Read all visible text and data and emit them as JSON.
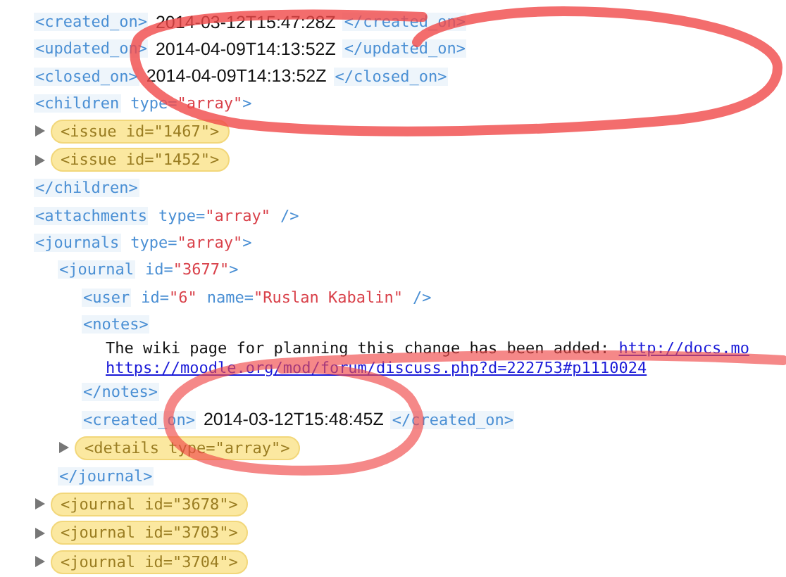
{
  "nodes": [
    {
      "kind": "leaf",
      "open": "<created_on>",
      "value": "2014-03-12T15:47:28Z",
      "close": "</created_on>"
    },
    {
      "kind": "leaf",
      "open": "<updated_on>",
      "value": "2014-04-09T14:13:52Z",
      "close": "</updated_on>"
    },
    {
      "kind": "leaf",
      "open": "<closed_on>",
      "value": "2014-04-09T14:13:52Z",
      "close": "</closed_on>"
    },
    {
      "kind": "element",
      "open": "<children",
      "attrs": [
        {
          "name": "type=",
          "value": "\"array\""
        }
      ],
      "end": ">",
      "close": "</children>",
      "children": [
        {
          "kind": "collapsed",
          "open": "<issue",
          "attrs": [
            {
              "name": "id=",
              "value": "\"1467\""
            }
          ],
          "end": ">"
        },
        {
          "kind": "collapsed",
          "open": "<issue",
          "attrs": [
            {
              "name": "id=",
              "value": "\"1452\""
            }
          ],
          "end": ">"
        }
      ]
    },
    {
      "kind": "empty",
      "open": "<attachments",
      "attrs": [
        {
          "name": "type=",
          "value": "\"array\""
        }
      ],
      "end": "/>"
    },
    {
      "kind": "element",
      "open": "<journals",
      "attrs": [
        {
          "name": "type=",
          "value": "\"array\""
        }
      ],
      "end": ">",
      "children": [
        {
          "kind": "element",
          "open": "<journal",
          "attrs": [
            {
              "name": "id=",
              "value": "\"3677\""
            }
          ],
          "end": ">",
          "close": "</journal>",
          "children": [
            {
              "kind": "empty",
              "open": "<user",
              "attrs": [
                {
                  "name": "id=",
                  "value": "\"6\""
                },
                {
                  "name": "name=",
                  "value": "\"Ruslan Kabalin\""
                }
              ],
              "end": "/>"
            },
            {
              "kind": "text",
              "open": "<notes>",
              "text": "The wiki page for planning this change has been added:",
              "links": [
                "http://docs.mo",
                "https://moodle.org/mod/forum/discuss.php?d=222753#p1110024"
              ],
              "close": "</notes>"
            },
            {
              "kind": "leaf",
              "open": "<created_on>",
              "value": "2014-03-12T15:48:45Z",
              "close": "</created_on>"
            },
            {
              "kind": "collapsed",
              "open": "<details",
              "attrs": [
                {
                  "name": "type=",
                  "value": "\"array\""
                }
              ],
              "end": ">"
            }
          ]
        },
        {
          "kind": "collapsed",
          "open": "<journal",
          "attrs": [
            {
              "name": "id=",
              "value": "\"3678\""
            }
          ],
          "end": ">"
        },
        {
          "kind": "collapsed",
          "open": "<journal",
          "attrs": [
            {
              "name": "id=",
              "value": "\"3703\""
            }
          ],
          "end": ">"
        },
        {
          "kind": "collapsed",
          "open": "<journal",
          "attrs": [
            {
              "name": "id=",
              "value": "\"3704\""
            }
          ],
          "end": ">"
        }
      ]
    }
  ]
}
